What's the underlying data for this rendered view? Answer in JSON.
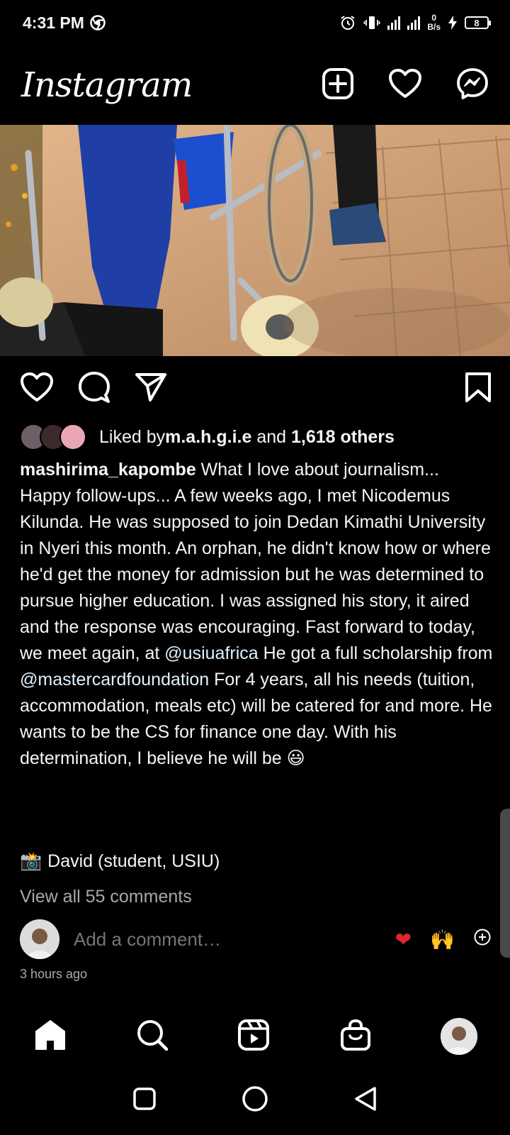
{
  "status_bar": {
    "time": "4:31 PM",
    "net_speed_value": "0",
    "net_speed_unit": "B/s",
    "battery": "8"
  },
  "header": {
    "logo": "Instagram"
  },
  "post": {
    "liked_by_prefix": "Liked by ",
    "liked_by_user": "m.a.h.g.i.e",
    "liked_by_and": " and ",
    "liked_by_others": "1,618 others",
    "author": "mashirima_kapombe",
    "caption_part1": " What I love about journalism... Happy follow-ups... A few weeks ago, I met Nicodemus Kilunda. He was supposed to join Dedan Kimathi University in Nyeri this month. An orphan, he didn't know how or where he'd get the money for admission but he was determined to pursue higher education. I was assigned his story, it aired and the response was encouraging. Fast forward to today, we meet again, at ",
    "mention1": "@usiuafrica",
    "caption_part2": " He got a full scholarship from ",
    "mention2": "@mastercardfoundation",
    "caption_part3": " For 4 years, all his needs (tuition, accommodation, meals etc) will be catered for and more. He wants to be the CS for finance one day. With his determination, I believe he will be ",
    "caption_emoji": "😃",
    "photo_credit_emoji": "📸",
    "photo_credit": "David (student, USIU)",
    "view_comments": "View all 55 comments",
    "comment_placeholder": "Add a comment…",
    "quick_reactions": [
      "❤",
      "🙌"
    ],
    "timestamp": "3 hours ago"
  },
  "icons": {
    "new_post": "plus-square-icon",
    "activity": "heart-icon",
    "messenger": "messenger-icon",
    "like": "heart-outline-icon",
    "comment": "comment-icon",
    "share": "paper-plane-icon",
    "save": "bookmark-icon"
  },
  "colors": {
    "background": "#000000",
    "text": "#f5f5f5",
    "muted": "#a8a8a8",
    "reaction_heart": "#e0252d"
  }
}
